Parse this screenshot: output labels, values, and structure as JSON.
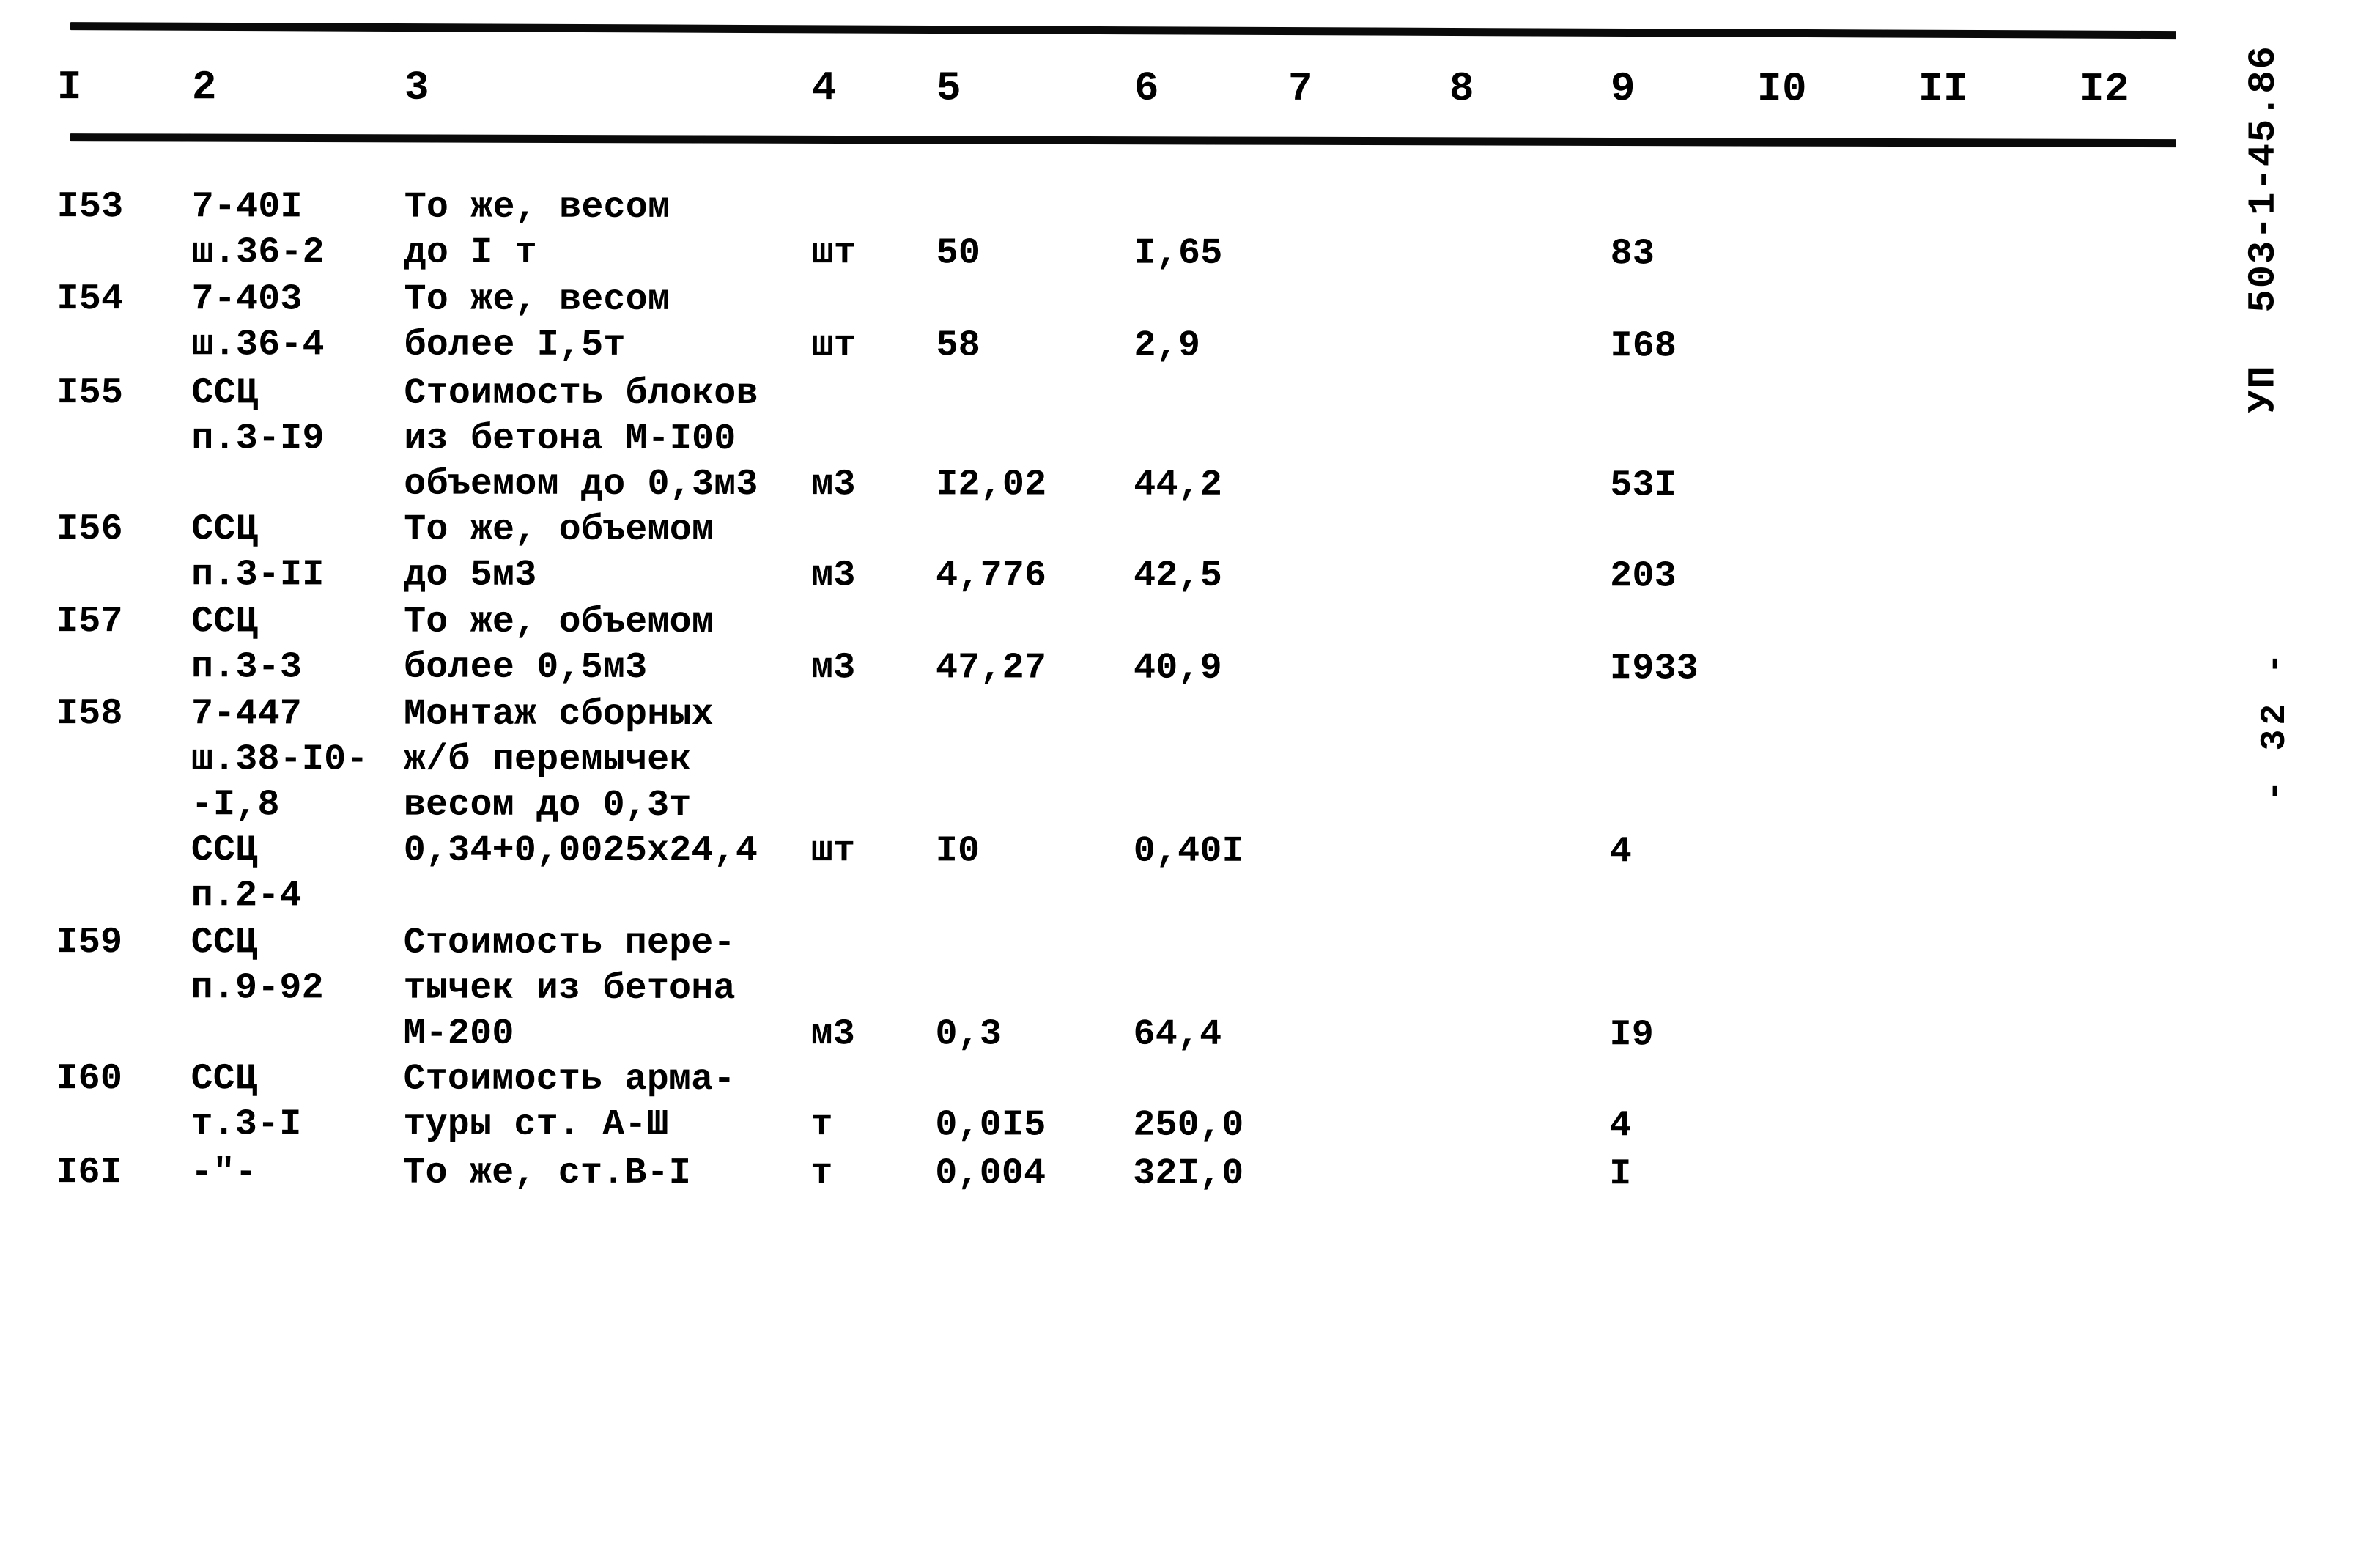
{
  "document": {
    "code_stamp": "503-1-45.86",
    "sheet_stamp": "УП",
    "page_stamp": "- 32 -"
  },
  "table": {
    "column_headers": [
      "I",
      "2",
      "3",
      "4",
      "5",
      "6",
      "7",
      "8",
      "9",
      "I0",
      "II",
      "I2"
    ],
    "rows": [
      {
        "c1": "I53",
        "c2": [
          "7-40I",
          "ш.36-2"
        ],
        "c3": [
          "То же, весом",
          "до I т"
        ],
        "c4": "шт",
        "c5": "50",
        "c6": "I,65",
        "c7": "",
        "c8": "",
        "c9": "83",
        "c10": "",
        "c11": "",
        "c12": ""
      },
      {
        "c1": "I54",
        "c2": [
          "7-403",
          "ш.36-4"
        ],
        "c3": [
          "То же, весом",
          "более I,5т"
        ],
        "c4": "шт",
        "c5": "58",
        "c6": "2,9",
        "c7": "",
        "c8": "",
        "c9": "I68",
        "c10": "",
        "c11": "",
        "c12": ""
      },
      {
        "c1": "I55",
        "c2": [
          "ССЦ",
          "п.3-I9"
        ],
        "c3": [
          "Стоимость блоков",
          "из бетона М-I00",
          "объемом до 0,3м3"
        ],
        "c4": "м3",
        "c5": "I2,02",
        "c6": "44,2",
        "c7": "",
        "c8": "",
        "c9": "53I",
        "c10": "",
        "c11": "",
        "c12": ""
      },
      {
        "c1": "I56",
        "c2": [
          "ССЦ",
          "п.3-II"
        ],
        "c3": [
          "То же, объемом",
          "до 5м3"
        ],
        "c4": "м3",
        "c5": "4,776",
        "c6": "42,5",
        "c7": "",
        "c8": "",
        "c9": "203",
        "c10": "",
        "c11": "",
        "c12": ""
      },
      {
        "c1": "I57",
        "c2": [
          "ССЦ",
          "п.3-3"
        ],
        "c3": [
          "То же, объемом",
          "более 0,5м3"
        ],
        "c4": "м3",
        "c5": "47,27",
        "c6": "40,9",
        "c7": "",
        "c8": "",
        "c9": "I933",
        "c10": "",
        "c11": "",
        "c12": ""
      },
      {
        "c1": "I58",
        "c2": [
          "7-447",
          "ш.38-I0-",
          "-I,8",
          "ССЦ",
          "п.2-4"
        ],
        "c3": [
          "Монтаж сборных",
          "ж/б перемычек",
          "весом до 0,3т",
          "0,34+0,0025х24,4"
        ],
        "c4": "шт",
        "c5": "I0",
        "c6": "0,40I",
        "c7": "",
        "c8": "",
        "c9": "4",
        "c10": "",
        "c11": "",
        "c12": ""
      },
      {
        "c1": "I59",
        "c2": [
          "ССЦ",
          "п.9-92"
        ],
        "c3": [
          "Стоимость пере-",
          "тычек из бетона",
          "М-200"
        ],
        "c4": "м3",
        "c5": "0,3",
        "c6": "64,4",
        "c7": "",
        "c8": "",
        "c9": "I9",
        "c10": "",
        "c11": "",
        "c12": ""
      },
      {
        "c1": "I60",
        "c2": [
          "ССЦ",
          "т.3-I"
        ],
        "c3": [
          "Стоимость арма-",
          "туры ст. А-Ш"
        ],
        "c4": "т",
        "c5": "0,0I5",
        "c6": "250,0",
        "c7": "",
        "c8": "",
        "c9": "4",
        "c10": "",
        "c11": "",
        "c12": ""
      },
      {
        "c1": "I6I",
        "c2": [
          "-\"-"
        ],
        "c3": [
          "То же, ст.В-I"
        ],
        "c4": "т",
        "c5": "0,004",
        "c6": "32I,0",
        "c7": "",
        "c8": "",
        "c9": "I",
        "c10": "",
        "c11": "",
        "c12": ""
      }
    ]
  }
}
